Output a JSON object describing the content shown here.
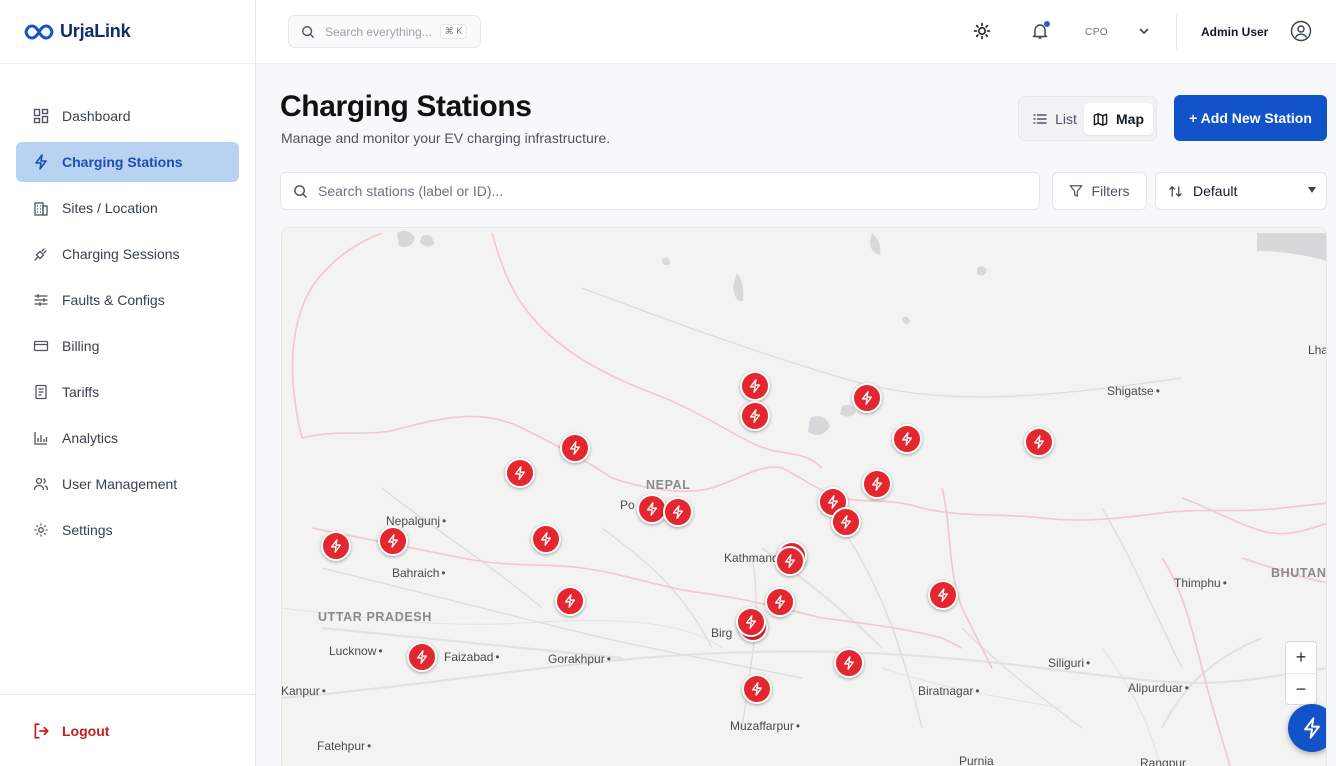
{
  "brand": {
    "name": "UrjaLink"
  },
  "sidebar": {
    "items": [
      {
        "label": "Dashboard",
        "icon": "grid-icon"
      },
      {
        "label": "Charging Stations",
        "icon": "bolt-icon",
        "active": true
      },
      {
        "label": "Sites / Location",
        "icon": "building-icon"
      },
      {
        "label": "Charging Sessions",
        "icon": "plug-icon"
      },
      {
        "label": "Faults & Configs",
        "icon": "sliders-icon"
      },
      {
        "label": "Billing",
        "icon": "card-icon"
      },
      {
        "label": "Tariffs",
        "icon": "document-icon"
      },
      {
        "label": "Analytics",
        "icon": "bar-chart-icon"
      },
      {
        "label": "User Management",
        "icon": "users-icon"
      },
      {
        "label": "Settings",
        "icon": "gear-icon"
      }
    ],
    "logout_label": "Logout"
  },
  "topbar": {
    "search_placeholder": "Search everything...",
    "search_shortcut": "⌘ K",
    "role": "CPO",
    "user_name": "Admin User"
  },
  "page": {
    "title": "Charging Stations",
    "subtitle": "Manage and monitor your EV charging infrastructure.",
    "view_list_label": "List",
    "view_map_label": "Map",
    "active_view": "Map",
    "add_button_label": "+ Add New Station",
    "search_placeholder": "Search stations (label or ID)...",
    "filters_label": "Filters",
    "sort_value": "Default"
  },
  "map": {
    "regions": [
      "NEPAL",
      "UTTAR PRADESH",
      "BHUTAN"
    ],
    "cities": [
      "Nepalgunj",
      "Bahraich",
      "Lucknow",
      "Faizabad",
      "Gorakhpur",
      "Kanpur",
      "Fatehpur",
      "Po",
      "Kathmandu",
      "Birg",
      "Muzaffarpur",
      "Biratnagar",
      "Siliguri",
      "Alipurduar",
      "Thimphu",
      "Shigatse",
      "Lha",
      "Purnia",
      "Rangpur"
    ],
    "zoom_in": "+",
    "zoom_out": "−",
    "station_count": 27,
    "marker_color": "#e4262f"
  }
}
